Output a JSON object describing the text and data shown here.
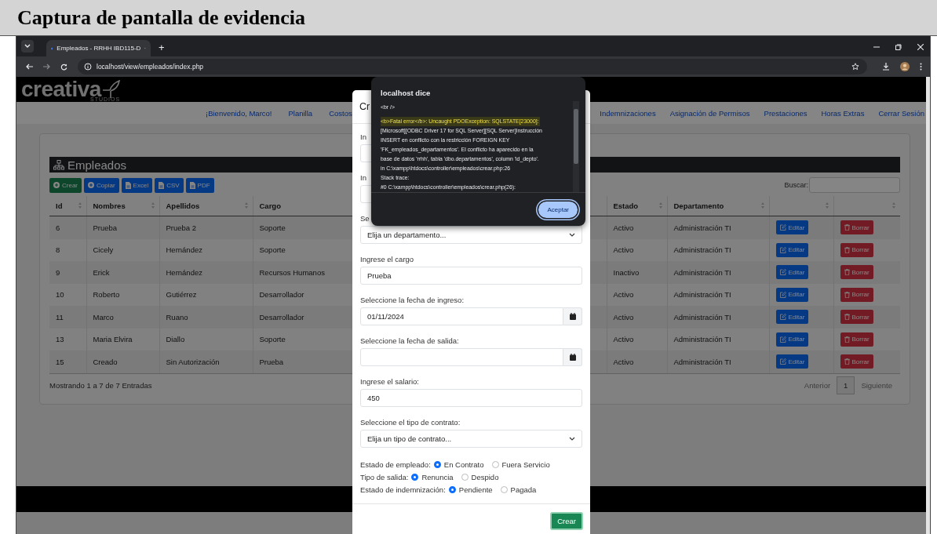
{
  "document_title": "Captura de pantalla de evidencia",
  "browser": {
    "tab_title": "Empleados - RRHH IBD115-D",
    "new_tab": "+",
    "url": "localhost/view/empleados/index.php"
  },
  "site": {
    "logo": "creativa",
    "logo_sub": "STUDIOS",
    "nav_left": [
      "¡Bienvenido, Marco!",
      "Planilla",
      "Costos"
    ],
    "nav_right": [
      "Indemnizaciones",
      "Asignación de Permisos",
      "Prestaciones",
      "Horas Extras",
      "Cerrar Sesión"
    ]
  },
  "card": {
    "title": "Empleados",
    "buttons": [
      {
        "label": "Crear",
        "kind": "create"
      },
      {
        "label": "Copiar",
        "kind": "copy"
      },
      {
        "label": "Excel",
        "kind": "file"
      },
      {
        "label": "CSV",
        "kind": "file"
      },
      {
        "label": "PDF",
        "kind": "file"
      }
    ],
    "search_label": "Buscar:",
    "columns_left": [
      "Id",
      "Nombres",
      "Apellidos",
      "Cargo"
    ],
    "columns_right": [
      "Estado",
      "Departamento"
    ],
    "rows": [
      {
        "id": "6",
        "nombres": "Prueba",
        "apellidos": "Prueba 2",
        "cargo": "Soporte",
        "estado": "Activo",
        "departamento": "Administración TI",
        "edit": "Editar",
        "delete": "Borrar"
      },
      {
        "id": "8",
        "nombres": "Cicely",
        "apellidos": "Hernández",
        "cargo": "Soporte",
        "estado": "Activo",
        "departamento": "Administración TI",
        "edit": "Editar",
        "delete": "Borrar"
      },
      {
        "id": "9",
        "nombres": "Erick",
        "apellidos": "Hernández",
        "cargo": "Recursos Humanos",
        "estado": "Inactivo",
        "departamento": "Administración TI",
        "edit": "Editar",
        "delete": "Borrar"
      },
      {
        "id": "10",
        "nombres": "Roberto",
        "apellidos": "Gutiérrez",
        "cargo": "Desarrollador",
        "estado": "Activo",
        "departamento": "Administración TI",
        "edit": "Editar",
        "delete": "Borrar"
      },
      {
        "id": "11",
        "nombres": "Marco",
        "apellidos": "Ruano",
        "cargo": "Desarrollador",
        "estado": "Activo",
        "departamento": "Administración TI",
        "edit": "Editar",
        "delete": "Borrar"
      },
      {
        "id": "13",
        "nombres": "Maria Elvira",
        "apellidos": "Diallo",
        "cargo": "Soporte",
        "estado": "Activo",
        "departamento": "Administración TI",
        "edit": "Editar",
        "delete": "Borrar"
      },
      {
        "id": "15",
        "nombres": "Creado",
        "apellidos": "Sin Autorización",
        "cargo": "Prueba",
        "estado": "Activo",
        "departamento": "Administración TI",
        "edit": "Editar",
        "delete": "Borrar"
      }
    ],
    "info": "Mostrando 1 a 7 de 7 Entradas",
    "pagination": {
      "previous": "Anterior",
      "page": "1",
      "next": "Siguiente"
    }
  },
  "modal": {
    "title": "Cr",
    "fields": [
      {
        "kind": "text",
        "label": "In"
      },
      {
        "kind": "text",
        "label": "In"
      },
      {
        "kind": "select",
        "label": "Se",
        "value": "Elija un departamento..."
      },
      {
        "kind": "text",
        "label": "Ingrese el cargo",
        "value": "Prueba"
      },
      {
        "kind": "date",
        "label": "Seleccione la fecha de ingreso:",
        "value": "01/11/2024"
      },
      {
        "kind": "date",
        "label": "Seleccione la fecha de salida:"
      },
      {
        "kind": "text",
        "label": "Ingrese el salario:",
        "value": "450"
      },
      {
        "kind": "select",
        "label": "Seleccione el tipo de contrato:",
        "value": "Elija un tipo de contrato..."
      }
    ],
    "radio_groups": [
      {
        "label": "Estado de empleado:",
        "options": [
          {
            "label": "En Contrato",
            "selected": true
          },
          {
            "label": "Fuera Servicio",
            "selected": false
          }
        ]
      },
      {
        "label": "Tipo de salida:",
        "options": [
          {
            "label": "Renuncia",
            "selected": true
          },
          {
            "label": "Despido",
            "selected": false
          }
        ]
      },
      {
        "label": "Estado de indemnización:",
        "options": [
          {
            "label": "Pendiente",
            "selected": true
          },
          {
            "label": "Pagada",
            "selected": false
          }
        ]
      }
    ],
    "submit": "Crear"
  },
  "alert": {
    "title": "localhost dice",
    "lines": [
      {
        "text": "<br />",
        "highlighted": false
      },
      {
        "text": "<b>Fatal error</b>:  Uncaught PDOException: SQLSTATE[23000]:",
        "highlighted": true
      },
      {
        "text": "[Microsoft][ODBC Driver 17 for SQL Server][SQL Server]Instrucción",
        "highlighted": false
      },
      {
        "text": "INSERT en conflicto con la restricción FOREIGN KEY",
        "highlighted": false
      },
      {
        "text": "'FK_empleados_departamentos'. El conflicto ha aparecido en la",
        "highlighted": false
      },
      {
        "text": "base de datos 'rrhh', tabla 'dbo.departamentos', column 'id_depto'.",
        "highlighted": false
      },
      {
        "text": "in C:\\xampp\\htdocs\\controller\\empleados\\crear.php:26",
        "highlighted": false
      },
      {
        "text": "Stack trace:",
        "highlighted": false
      },
      {
        "text": "#0 C:\\xampp\\htdocs\\controller\\empleados\\crear.php(26):",
        "highlighted": false
      }
    ],
    "button": "Aceptar"
  }
}
